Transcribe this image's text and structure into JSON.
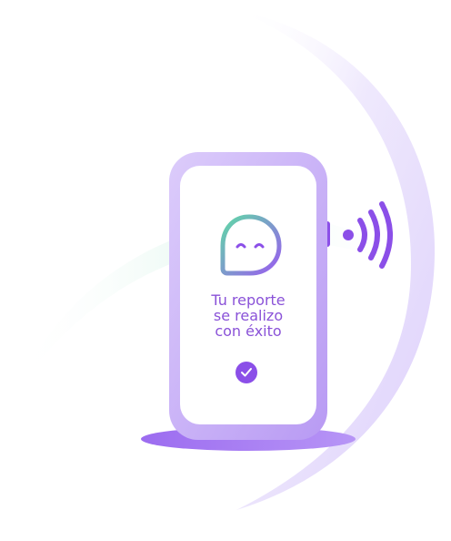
{
  "message": {
    "line1": "Tu reporte",
    "line2": "se realizo",
    "line3": "con éxito"
  },
  "colors": {
    "primary": "#8b4fe8",
    "text": "#8a52d8",
    "phone_frame": "#c9b2f7",
    "phone_screen": "#ffffff",
    "gradient_start": "#5fd9a6",
    "gradient_end": "#9a5cf0"
  },
  "icons": {
    "chat": "chat-bubble-icon",
    "check": "checkmark-icon",
    "signal": "wireless-signal-icon"
  }
}
